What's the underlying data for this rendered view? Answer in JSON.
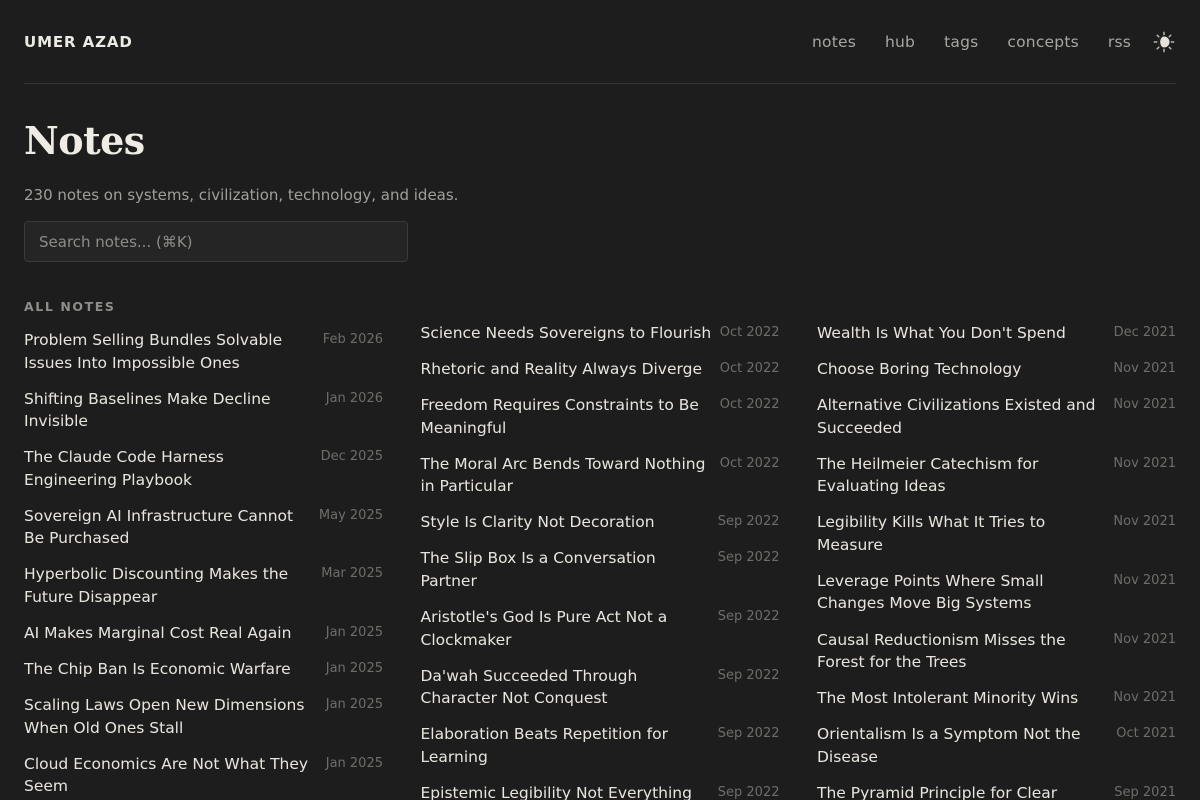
{
  "header": {
    "brand": "UMER AZAD",
    "nav": [
      "notes",
      "hub",
      "tags",
      "concepts",
      "rss"
    ],
    "theme_icon": "sun-moon-icon"
  },
  "page": {
    "title": "Notes",
    "subtitle": "230 notes on systems, civilization, technology, and ideas.",
    "search_placeholder": "Search notes... (⌘K)",
    "section_label": "ALL NOTES"
  },
  "columns": [
    [
      {
        "title": "Problem Selling Bundles Solvable Issues Into Impossible Ones",
        "date": "Feb 2026"
      },
      {
        "title": "Shifting Baselines Make Decline Invisible",
        "date": "Jan 2026"
      },
      {
        "title": "The Claude Code Harness Engineering Playbook",
        "date": "Dec 2025"
      },
      {
        "title": "Sovereign AI Infrastructure Cannot Be Purchased",
        "date": "May 2025"
      },
      {
        "title": "Hyperbolic Discounting Makes the Future Disappear",
        "date": "Mar 2025"
      },
      {
        "title": "AI Makes Marginal Cost Real Again",
        "date": "Jan 2025"
      },
      {
        "title": "The Chip Ban Is Economic Warfare",
        "date": "Jan 2025"
      },
      {
        "title": "Scaling Laws Open New Dimensions When Old Ones Stall",
        "date": "Jan 2025"
      },
      {
        "title": "Cloud Economics Are Not What They Seem",
        "date": "Jan 2025"
      }
    ],
    [
      {
        "title": "Science Needs Sovereigns to Flourish",
        "date": "Oct 2022"
      },
      {
        "title": "Rhetoric and Reality Always Diverge",
        "date": "Oct 2022"
      },
      {
        "title": "Freedom Requires Constraints to Be Meaningful",
        "date": "Oct 2022"
      },
      {
        "title": "The Moral Arc Bends Toward Nothing in Particular",
        "date": "Oct 2022"
      },
      {
        "title": "Style Is Clarity Not Decoration",
        "date": "Sep 2022"
      },
      {
        "title": "The Slip Box Is a Conversation Partner",
        "date": "Sep 2022"
      },
      {
        "title": "Aristotle's God Is Pure Act Not a Clockmaker",
        "date": "Sep 2022"
      },
      {
        "title": "Da'wah Succeeded Through Character Not Conquest",
        "date": "Sep 2022"
      },
      {
        "title": "Elaboration Beats Repetition for Learning",
        "date": "Sep 2022"
      },
      {
        "title": "Epistemic Legibility Not Everything Can Be Made Explicit",
        "date": "Sep 2022"
      }
    ],
    [
      {
        "title": "Wealth Is What You Don't Spend",
        "date": "Dec 2021"
      },
      {
        "title": "Choose Boring Technology",
        "date": "Nov 2021"
      },
      {
        "title": "Alternative Civilizations Existed and Succeeded",
        "date": "Nov 2021"
      },
      {
        "title": "The Heilmeier Catechism for Evaluating Ideas",
        "date": "Nov 2021"
      },
      {
        "title": "Legibility Kills What It Tries to Measure",
        "date": "Nov 2021"
      },
      {
        "title": "Leverage Points Where Small Changes Move Big Systems",
        "date": "Nov 2021"
      },
      {
        "title": "Causal Reductionism Misses the Forest for the Trees",
        "date": "Nov 2021"
      },
      {
        "title": "The Most Intolerant Minority Wins",
        "date": "Nov 2021"
      },
      {
        "title": "Orientalism Is a Symptom Not the Disease",
        "date": "Oct 2021"
      },
      {
        "title": "The Pyramid Principle for Clear Communication",
        "date": "Sep 2021"
      }
    ]
  ]
}
